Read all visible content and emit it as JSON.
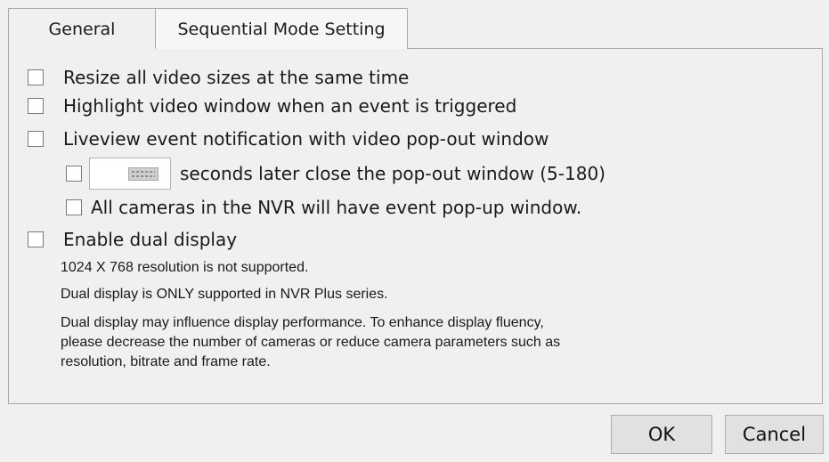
{
  "tabs": {
    "general": "General",
    "sequential": "Sequential Mode Setting"
  },
  "options": {
    "resize_all": {
      "label": "Resize all video sizes at the same time",
      "checked": false
    },
    "highlight": {
      "label": "Highlight video window when an event is triggered",
      "checked": false
    },
    "liveview_popout": {
      "label": "Liveview event notification with video pop-out window",
      "checked": false
    },
    "close_later": {
      "label": "seconds later close the pop-out window (5-180)",
      "checked": false,
      "value": ""
    },
    "all_cameras": {
      "label": "All cameras in the NVR will have event pop-up window.",
      "checked": false
    },
    "dual_display": {
      "label": "Enable dual display",
      "checked": false
    }
  },
  "notes": {
    "resolution": "1024 X 768 resolution is not supported.",
    "plus_only": "Dual display is ONLY supported in NVR Plus series.",
    "performance_1": "Dual display may influence display performance. To enhance display fluency,",
    "performance_2": "please decrease the number of cameras or reduce camera parameters such as",
    "performance_3": "resolution, bitrate and frame rate."
  },
  "buttons": {
    "ok": "OK",
    "cancel": "Cancel"
  },
  "icons": {
    "spin_icon": "keyboard-icon"
  },
  "colors": {
    "background": "#f0f0f0",
    "border": "#a8a8a8",
    "button_bg": "#e1e1e1"
  }
}
